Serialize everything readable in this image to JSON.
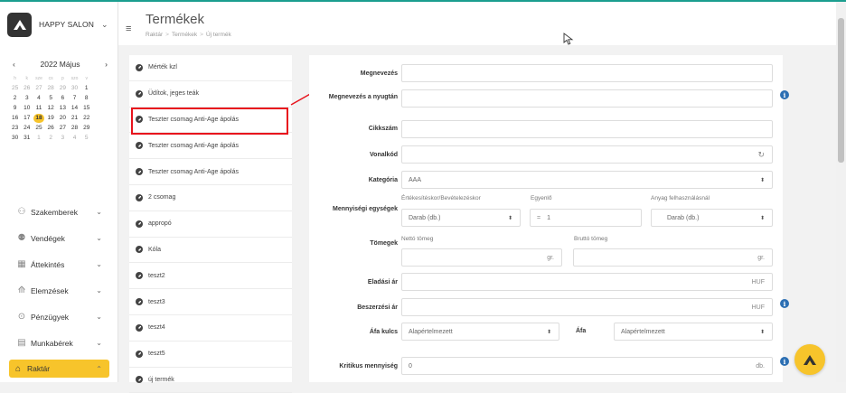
{
  "brand": {
    "name": "HAPPY SALON"
  },
  "calendar": {
    "month_label": "2022 Május",
    "weekdays": [
      "h",
      "k",
      "sze",
      "cs",
      "p",
      "szo",
      "v"
    ],
    "weeks": [
      [
        "25",
        "26",
        "27",
        "28",
        "29",
        "30",
        "1"
      ],
      [
        "2",
        "3",
        "4",
        "5",
        "6",
        "7",
        "8"
      ],
      [
        "9",
        "10",
        "11",
        "12",
        "13",
        "14",
        "15"
      ],
      [
        "16",
        "17",
        "18",
        "19",
        "20",
        "21",
        "22"
      ],
      [
        "23",
        "24",
        "25",
        "26",
        "27",
        "28",
        "29"
      ],
      [
        "30",
        "31",
        "1",
        "2",
        "3",
        "4",
        "5"
      ]
    ],
    "today": "18"
  },
  "nav": {
    "items": [
      {
        "label": "Szakemberek",
        "icon": "person-icon"
      },
      {
        "label": "Vendégek",
        "icon": "people-icon"
      },
      {
        "label": "Áttekintés",
        "icon": "grid-icon"
      },
      {
        "label": "Elemzések",
        "icon": "chart-icon"
      },
      {
        "label": "Pénzügyek",
        "icon": "coin-icon"
      },
      {
        "label": "Munkabérek",
        "icon": "wallet-icon"
      },
      {
        "label": "Raktár",
        "icon": "warehouse-icon",
        "active": true
      }
    ]
  },
  "header": {
    "title": "Termékek",
    "breadcrumb": [
      "Raktár",
      "Termékek",
      "Új termék"
    ]
  },
  "products": {
    "items": [
      "Mérték kzl",
      "Üdítok, jeges teák",
      "Teszter csomag Anti-Age ápolás",
      "Teszter csomag Anti-Age ápolás",
      "Teszter csomag Anti-Age ápolás",
      "2 csomag",
      "appropó",
      "Kóla",
      "teszt2",
      "teszt3",
      "teszt4",
      "teszt5",
      "új termék"
    ]
  },
  "form": {
    "name_label": "Megnevezés",
    "name_foreign_label": "Megnevezés a nyugtán",
    "sku_label": "Cikkszám",
    "barcode_label": "Vonalkód",
    "category_label": "Kategória",
    "category_value": "AAA",
    "units_label": "Mennyiségi egységek",
    "units_sub_sale": "Értékesítéskor/Bevételezéskor",
    "units_sub_equal": "Egyenlő",
    "units_sub_usage": "Anyag felhasználásnál",
    "units_sale_value": "Darab (db.)",
    "units_equal_prefix": "=",
    "units_equal_value": "1",
    "units_usage_value": "Darab (db.)",
    "weights_label": "Tömegek",
    "weight_net_label": "Nettó tömeg",
    "weight_gross_label": "Bruttó tömeg",
    "weight_unit": "gr.",
    "sale_price_label": "Eladási ár",
    "purchase_price_label": "Beszerzési ár",
    "currency": "HUF",
    "vat_key_label": "Áfa kulcs",
    "vat_key_value": "Alapértelmezett",
    "vat_label": "Áfa",
    "vat_value": "Alapértelmezett",
    "critical_label": "Kritikus mennyiség",
    "critical_value": "0",
    "critical_unit": "db."
  },
  "colors": {
    "accent": "#f7c42b",
    "highlight": "#e8141d",
    "info": "#2c6fb3"
  }
}
